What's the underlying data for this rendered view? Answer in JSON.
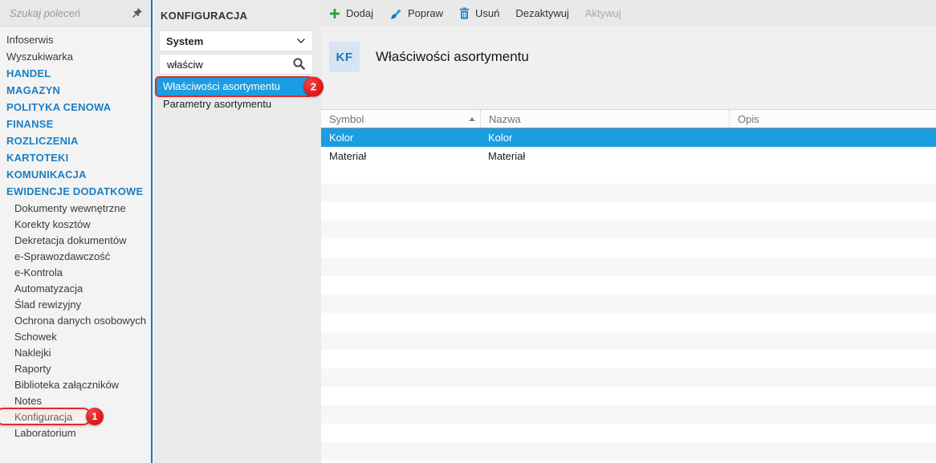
{
  "colors": {
    "accent_blue": "#1b9de2",
    "category_blue": "#1b7fc4",
    "annotation_red": "#e02b2b",
    "icon_green": "#2f9e34",
    "icon_blue": "#1b8fd0",
    "badge_bg": "#d7e5f2",
    "badge_text": "#1878be"
  },
  "sidebar": {
    "search_placeholder": "Szukaj poleceń",
    "items": [
      {
        "label": "Infoserwis",
        "type": "top"
      },
      {
        "label": "Wyszukiwarka",
        "type": "top"
      },
      {
        "label": "HANDEL",
        "type": "category"
      },
      {
        "label": "MAGAZYN",
        "type": "category"
      },
      {
        "label": "POLITYKA CENOWA",
        "type": "category"
      },
      {
        "label": "FINANSE",
        "type": "category"
      },
      {
        "label": "ROZLICZENIA",
        "type": "category"
      },
      {
        "label": "KARTOTEKI",
        "type": "category"
      },
      {
        "label": "KOMUNIKACJA",
        "type": "category"
      },
      {
        "label": "EWIDENCJE DODATKOWE",
        "type": "category"
      },
      {
        "label": "Dokumenty wewnętrzne",
        "type": "sub"
      },
      {
        "label": "Korekty kosztów",
        "type": "sub"
      },
      {
        "label": "Dekretacja dokumentów",
        "type": "sub"
      },
      {
        "label": "e-Sprawozdawczość",
        "type": "sub"
      },
      {
        "label": "e-Kontrola",
        "type": "sub"
      },
      {
        "label": "Automatyzacja",
        "type": "sub"
      },
      {
        "label": "Ślad rewizyjny",
        "type": "sub"
      },
      {
        "label": "Ochrona danych osobowych",
        "type": "sub"
      },
      {
        "label": "Schowek",
        "type": "sub"
      },
      {
        "label": "Naklejki",
        "type": "sub"
      },
      {
        "label": "Raporty",
        "type": "sub"
      },
      {
        "label": "Biblioteka załączników",
        "type": "sub"
      },
      {
        "label": "Notes",
        "type": "sub"
      },
      {
        "label": "Konfiguracja",
        "type": "sub",
        "annotation": "1"
      },
      {
        "label": "Laboratorium",
        "type": "sub"
      }
    ]
  },
  "panel": {
    "title": "KONFIGURACJA",
    "dropdown_value": "System",
    "search_value": "właściw",
    "items": [
      {
        "label": "Właściwości asortymentu",
        "selected": true,
        "annotation": "2"
      },
      {
        "label": "Parametry asortymentu",
        "selected": false
      }
    ]
  },
  "toolbar": {
    "add_label": "Dodaj",
    "edit_label": "Popraw",
    "delete_label": "Usuń",
    "deactivate_label": "Dezaktywuj",
    "activate_label": "Aktywuj"
  },
  "header": {
    "badge": "KF",
    "title": "Właściwości asortymentu"
  },
  "table": {
    "columns": [
      {
        "label": "Symbol",
        "sorted": "asc"
      },
      {
        "label": "Nazwa",
        "sorted": null
      },
      {
        "label": "Opis",
        "sorted": null
      }
    ],
    "rows": [
      {
        "symbol": "Kolor",
        "nazwa": "Kolor",
        "opis": "",
        "selected": true
      },
      {
        "symbol": "Materiał",
        "nazwa": "Materiał",
        "opis": "",
        "selected": false
      }
    ]
  }
}
